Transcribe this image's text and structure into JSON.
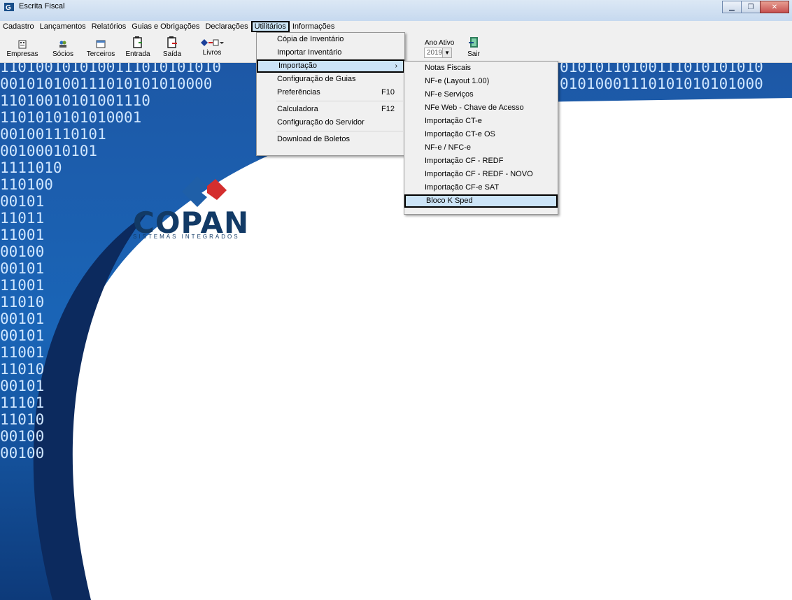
{
  "window": {
    "title": "Escrita Fiscal"
  },
  "menubar": [
    {
      "label": "Cadastro",
      "active": false
    },
    {
      "label": "Lançamentos",
      "active": false
    },
    {
      "label": "Relatórios",
      "active": false
    },
    {
      "label": "Guias e Obrigações",
      "active": false
    },
    {
      "label": "Declarações",
      "active": false
    },
    {
      "label": "Utilitários",
      "active": true
    },
    {
      "label": "Informações",
      "active": false
    }
  ],
  "toolbar": {
    "empresas": "Empresas",
    "socios": "Sócios",
    "terceiros": "Terceiros",
    "entrada": "Entrada",
    "saida": "Saída",
    "livros": "Livros",
    "ano_ativo_label": "Ano Ativo",
    "ano_ativo_value": "2019",
    "sair": "Sair"
  },
  "utilitarios_menu": {
    "items": [
      {
        "label": "Cópia de Inventário",
        "shortcut": ""
      },
      {
        "label": "Importar Inventário",
        "shortcut": ""
      },
      {
        "label": "Importação",
        "shortcut": "",
        "submenu": true,
        "highlighted": true
      },
      {
        "label": "Configuração de Guias",
        "shortcut": ""
      },
      {
        "label": "Preferências",
        "shortcut": "F10"
      },
      {
        "label": "Calculadora",
        "shortcut": "F12"
      },
      {
        "label": "Configuração do Servidor",
        "shortcut": ""
      },
      {
        "label": "Download de Boletos",
        "shortcut": ""
      }
    ]
  },
  "importacao_submenu": {
    "items": [
      {
        "label": "Notas Fiscais"
      },
      {
        "label": "NF-e (Layout 1.00)"
      },
      {
        "label": "NF-e Serviços"
      },
      {
        "label": "NFe Web - Chave de Acesso"
      },
      {
        "label": "Importação CT-e"
      },
      {
        "label": "Importação CT-e OS"
      },
      {
        "label": "NF-e / NFC-e"
      },
      {
        "label": "Importação CF - REDF"
      },
      {
        "label": "Importação CF - REDF - NOVO"
      },
      {
        "label": "Importação CF-e SAT"
      },
      {
        "label": "Bloco K Sped",
        "highlighted": true
      }
    ]
  },
  "logo": {
    "name": "COPAN",
    "tagline": "SISTEMAS INTEGRADOS"
  },
  "colors": {
    "menu_highlight": "#cce4f7",
    "background_blue": "#1f5fa8",
    "logo_blue": "#123a66",
    "logo_red": "#d42e2e"
  }
}
